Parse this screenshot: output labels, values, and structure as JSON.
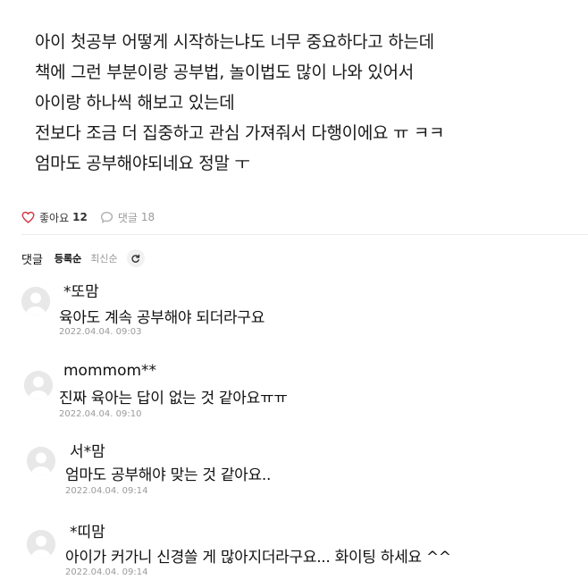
{
  "post": {
    "lines": [
      "아이 첫공부 어떻게 시작하는냐도 너무 중요하다고 하는데",
      "책에 그런 부분이랑 공부법, 놀이법도 많이 나와 있어서",
      "아이랑 하나씩 해보고 있는데",
      "전보다 조금 더 집중하고 관심 가져줘서 다행이에요 ㅠ ㅋㅋ",
      "엄마도 공부해야되네요 정말 ㅜ"
    ]
  },
  "reactions": {
    "like_label": "좋아요",
    "like_count": "12",
    "comment_label": "댓글",
    "comment_count": "18"
  },
  "comments_header": {
    "label": "댓글",
    "sort_options": [
      "등록순",
      "최신순"
    ],
    "selected_sort": "등록순"
  },
  "icons": {
    "like": "heart-icon",
    "comment": "speech-bubble-icon",
    "refresh": "refresh-icon",
    "avatar": "default-avatar-icon"
  },
  "colors": {
    "like_heart": "#d0303c",
    "muted_text": "#9a9a9a"
  },
  "comments": [
    {
      "author": "*또맘",
      "text": "육아도 계속 공부해야 되더라구요",
      "time": "2022.04.04. 09:03"
    },
    {
      "author": "mommom**",
      "text": "진짜 육아는 답이 없는 것 같아요ㅠㅠ",
      "time": "2022.04.04. 09:10"
    },
    {
      "author": "서*맘",
      "text": "엄마도 공부해야 맞는 것 같아요..",
      "time": "2022.04.04. 09:14"
    },
    {
      "author": "*띠맘",
      "text": "아이가 커가니 신경쓸 게 많아지더라구요... 화이팅 하세요 ^^",
      "time": "2022.04.04. 09:14"
    }
  ]
}
